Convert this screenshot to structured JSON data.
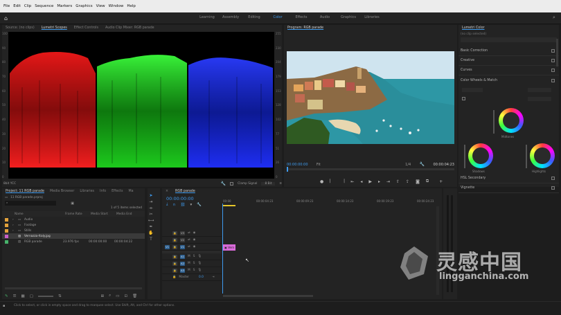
{
  "menubar": {
    "items": [
      "File",
      "Edit",
      "Clip",
      "Sequence",
      "Markers",
      "Graphics",
      "View",
      "Window",
      "Help"
    ]
  },
  "workspace": {
    "tabs": [
      "Learning",
      "Assembly",
      "Editing",
      "Color",
      "Effects",
      "Audio",
      "Graphics",
      "Libraries"
    ],
    "active": "Color"
  },
  "source_panel": {
    "tabs": [
      "Source: (no clips)",
      "Lumetri Scopes",
      "Effect Controls",
      "Audio Clip Mixer: RGB parade"
    ],
    "y_scale": [
      "100",
      "90",
      "80",
      "70",
      "60",
      "50",
      "40",
      "30",
      "20",
      "10",
      "0"
    ],
    "y_scale_right": [
      "255",
      "230",
      "204",
      "179",
      "153",
      "128",
      "102",
      "77",
      "51",
      "26",
      "0"
    ],
    "footer_left": "8bit  YCC",
    "clamp_label": "Clamp Signal",
    "bit_depth": "8 Bit"
  },
  "program_panel": {
    "title": "Program: RGB parade",
    "timecode_left": "00:00:00:00",
    "fit": "Fit",
    "zoom": "1/4",
    "timecode_right": "00:00:04:23",
    "landscape": {
      "sea": "#2e9aa8",
      "sky": "#cfe6f2",
      "land": "#8a6a3c"
    }
  },
  "lumetri": {
    "title": "Lumetri Color",
    "clip_selector": "(no clip selected)",
    "sections": [
      "Basic Correction",
      "Creative",
      "Curves",
      "Color Wheels & Match",
      "HSL Secondary",
      "Vignette"
    ],
    "wheels": [
      "Midtones",
      "Shadows",
      "Highlights"
    ]
  },
  "project_panel": {
    "tabs": [
      "Project: 11 RGB parade",
      "Media Browser",
      "Libraries",
      "Info",
      "Effects",
      "Ma"
    ],
    "path": "11 RGB parade.prproj",
    "selection": "1 of 5 items selected",
    "columns": [
      "Name",
      "Frame Rate",
      "Media Start",
      "Media End"
    ],
    "items": [
      {
        "name": "Audio",
        "color": "#e3a23b",
        "fps": "",
        "start": "",
        "end": "",
        "type": "folder"
      },
      {
        "name": "Footage",
        "color": "#e3a23b",
        "fps": "",
        "start": "",
        "end": "",
        "type": "folder"
      },
      {
        "name": "Stills",
        "color": "#e3a23b",
        "fps": "",
        "start": "",
        "end": "",
        "type": "folder"
      },
      {
        "name": "Vernazza-Italy.jpg",
        "color": "#c85fc8",
        "fps": "",
        "start": "",
        "end": "",
        "type": "file"
      },
      {
        "name": "RGB parade",
        "color": "#47b36b",
        "fps": "23.976 fps",
        "start": "00:00:00:00",
        "end": "00:00:04:22",
        "type": "sequence"
      }
    ]
  },
  "timeline": {
    "tab": "RGB parade",
    "timecode": "00:00:00:00",
    "ruler": [
      "00:00",
      "00:00:04:23",
      "00:00:09:23",
      "00:00:14:23",
      "00:00:19:23",
      "00:00:24:23"
    ],
    "video_tracks": [
      "V3",
      "V2",
      "V1"
    ],
    "audio_tracks": [
      "A1",
      "A2",
      "A3"
    ],
    "master": "Master",
    "master_value": "0.0",
    "clip_label": "Vern",
    "clip_color": "#d96ad9"
  },
  "statusbar": {
    "hint": "Click to select, or click in empty space and drag to marquee select. Use Shift, Alt, and Ctrl for other options."
  },
  "watermark": {
    "cn": "灵感中国",
    "en": "lingganchina.com"
  }
}
